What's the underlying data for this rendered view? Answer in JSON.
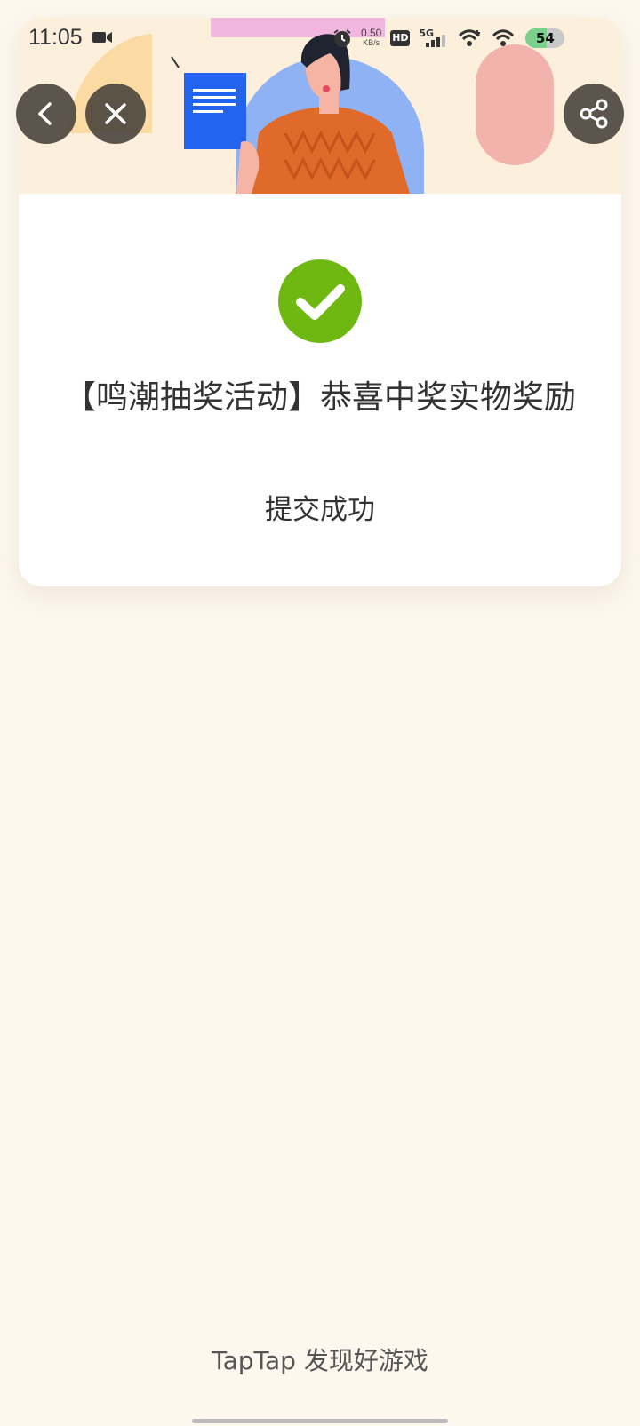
{
  "status_bar": {
    "time": "11:05",
    "net_speed_value": "0.50",
    "net_speed_unit": "KB/s",
    "hd_label": "HD",
    "network_label": "5G",
    "battery_level": "54"
  },
  "result": {
    "title": "【鸣潮抽奖活动】恭喜中奖实物奖励",
    "status": "提交成功"
  },
  "footer": {
    "text": "TapTap 发现好游戏"
  },
  "colors": {
    "background": "#fdf7ee",
    "success_green": "#6fb812",
    "overlay_button": "#46403a"
  }
}
